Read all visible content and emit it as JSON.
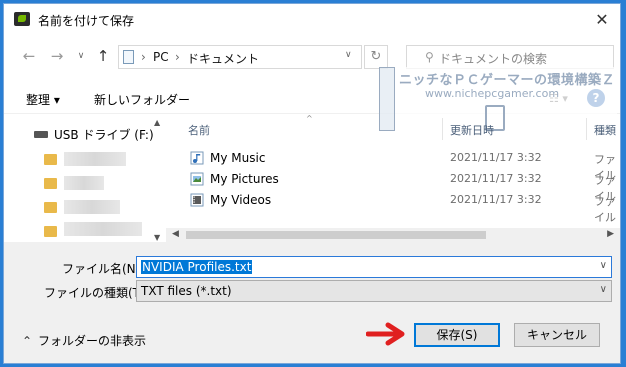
{
  "window": {
    "title": "名前を付けて保存"
  },
  "address": {
    "crumbs": [
      "PC",
      "ドキュメント"
    ],
    "search_placeholder": "ドキュメントの検索"
  },
  "toolbar": {
    "organize": "整理 ▾",
    "new_folder": "新しいフォルダー"
  },
  "watermark": {
    "line1": "ニッチなＰＣゲーマーの環境構築Ｚ",
    "line2": "www.nichepcgamer.com"
  },
  "nav_pane": {
    "usb_label": "USB ドライブ (F:)"
  },
  "columns": {
    "name": "名前",
    "date": "更新日時",
    "type": "種類"
  },
  "files": [
    {
      "name": "My Music",
      "date": "2021/11/17 3:32",
      "type": "ファイル",
      "icon": "music-folder-icon"
    },
    {
      "name": "My Pictures",
      "date": "2021/11/17 3:32",
      "type": "ファイル",
      "icon": "pictures-folder-icon"
    },
    {
      "name": "My Videos",
      "date": "2021/11/17 3:32",
      "type": "ファイル",
      "icon": "videos-folder-icon"
    }
  ],
  "form": {
    "filename_label": "ファイル名(N):",
    "filename_value": "NVIDIA Profiles.txt",
    "filetype_label": "ファイルの種類(T):",
    "filetype_value": "TXT files (*.txt)"
  },
  "footer": {
    "hide_folders": "フォルダーの非表示",
    "save": "保存(S)",
    "cancel": "キャンセル"
  },
  "colors": {
    "accent": "#0078d7",
    "arrow": "#e02020",
    "folder": "#e9b94a"
  }
}
